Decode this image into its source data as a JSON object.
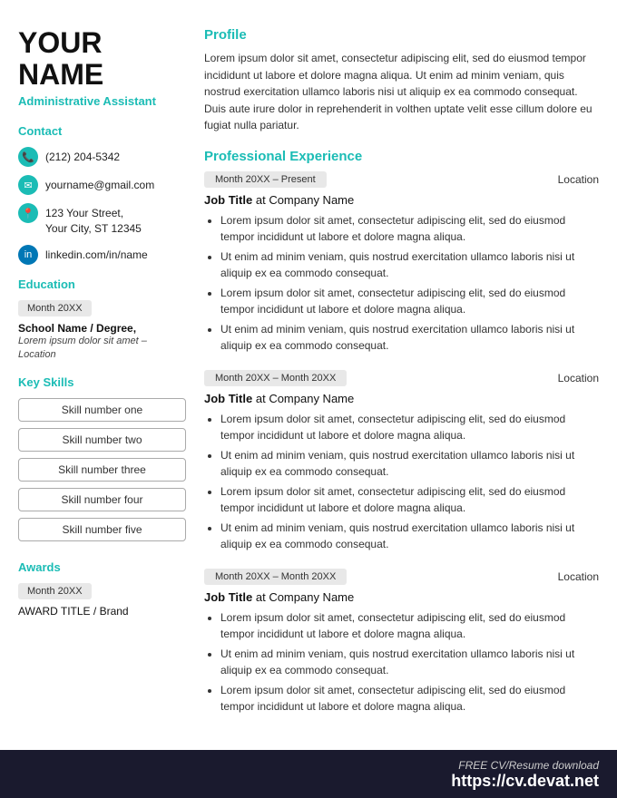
{
  "left": {
    "first_name": "YOUR",
    "last_name": "NAME",
    "job_title": "Administrative Assistant",
    "contact_heading": "Contact",
    "phone": "(212) 204-5342",
    "email": "yourname@gmail.com",
    "address_line1": "123 Your Street,",
    "address_line2": "Your City, ST 12345",
    "linkedin": "linkedin.com/in/name",
    "education_heading": "Education",
    "edu_date": "Month 20XX",
    "edu_school": "School Name / Degree,",
    "edu_detail": "Lorem ipsum dolor sit amet – Location",
    "skills_heading": "Key Skills",
    "skills": [
      "Skill number one",
      "Skill number two",
      "Skill number three",
      "Skill number four",
      "Skill number five"
    ],
    "awards_heading": "Awards",
    "award_date": "Month 20XX",
    "award_title": "AWARD TITLE / Brand"
  },
  "right": {
    "profile_heading": "Profile",
    "profile_text": "Lorem ipsum dolor sit amet, consectetur adipiscing elit, sed do eiusmod tempor incididunt ut labore et dolore magna aliqua. Ut enim ad minim veniam, quis nostrud exercitation ullamco laboris nisi ut aliquip ex ea commodo consequat. Duis aute irure dolor in reprehenderit in volthen uptate velit esse cillum dolore eu fugiat nulla pariatur.",
    "experience_heading": "Professional Experience",
    "experiences": [
      {
        "date": "Month 20XX – Present",
        "location": "Location",
        "job_title": "Job Title",
        "company": "Company Name",
        "bullets": [
          "Lorem ipsum dolor sit amet, consectetur adipiscing elit, sed do eiusmod tempor incididunt ut labore et dolore magna aliqua.",
          "Ut enim ad minim veniam, quis nostrud exercitation ullamco laboris nisi ut aliquip ex ea commodo consequat.",
          "Lorem ipsum dolor sit amet, consectetur adipiscing elit, sed do eiusmod tempor incididunt ut labore et dolore magna aliqua.",
          "Ut enim ad minim veniam, quis nostrud exercitation ullamco laboris nisi ut aliquip ex ea commodo consequat."
        ]
      },
      {
        "date": "Month 20XX – Month 20XX",
        "location": "Location",
        "job_title": "Job Title",
        "company": "Company Name",
        "bullets": [
          "Lorem ipsum dolor sit amet, consectetur adipiscing elit, sed do eiusmod tempor incididunt ut labore et dolore magna aliqua.",
          "Ut enim ad minim veniam, quis nostrud exercitation ullamco laboris nisi ut aliquip ex ea commodo consequat.",
          "Lorem ipsum dolor sit amet, consectetur adipiscing elit, sed do eiusmod tempor incididunt ut labore et dolore magna aliqua.",
          "Ut enim ad minim veniam, quis nostrud exercitation ullamco laboris nisi ut aliquip ex ea commodo consequat."
        ]
      },
      {
        "date": "Month 20XX – Month 20XX",
        "location": "Location",
        "job_title": "Job Title",
        "company": "Company Name",
        "bullets": [
          "Lorem ipsum dolor sit amet, consectetur adipiscing elit, sed do eiusmod tempor incididunt ut labore et dolore magna aliqua.",
          "Ut enim ad minim veniam, quis nostrud exercitation ullamco laboris nisi ut aliquip ex ea commodo consequat.",
          "Lorem ipsum dolor sit amet, consectetur adipiscing elit, sed do eiusmod tempor incididunt ut labore et dolore magna aliqua."
        ]
      }
    ]
  },
  "footer": {
    "free_label": "FREE CV/Resume download",
    "url": "https://cv.devat.net"
  }
}
